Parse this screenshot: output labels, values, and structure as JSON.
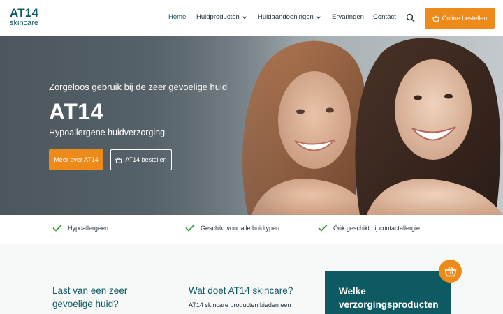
{
  "header": {
    "logo": {
      "main": "AT14",
      "sub": "skincare"
    },
    "nav": [
      {
        "label": "Home",
        "active": true
      },
      {
        "label": "Huidproducten",
        "dropdown": true
      },
      {
        "label": "Huidaandoeningen",
        "dropdown": true
      },
      {
        "label": "Ervaringen"
      },
      {
        "label": "Contact"
      }
    ],
    "order_button": "Online bestellen"
  },
  "hero": {
    "kicker": "Zorgeloos gebruik bij de zeer gevoelige huid",
    "title": "AT14",
    "subtitle": "Hypoallergene huidverzorging",
    "primary_button": "Meer over AT14",
    "secondary_button": "AT14 bestellen"
  },
  "usps": [
    {
      "label": "Hypoallergeen"
    },
    {
      "label": "Geschikt voor alle huidtypen"
    },
    {
      "label": "Óók geschikt bij contactallergie"
    }
  ],
  "sections": {
    "col1_title": "Last van een zeer gevoelige huid?",
    "col2_title": "Wat doet AT14 skincare?",
    "col2_text": "AT14 skincare producten bieden een",
    "card_title": "Welke verzorgingsproducten"
  },
  "colors": {
    "accent": "#ee8a1a",
    "brand": "#0e5a63",
    "check": "#3c9a3c"
  }
}
